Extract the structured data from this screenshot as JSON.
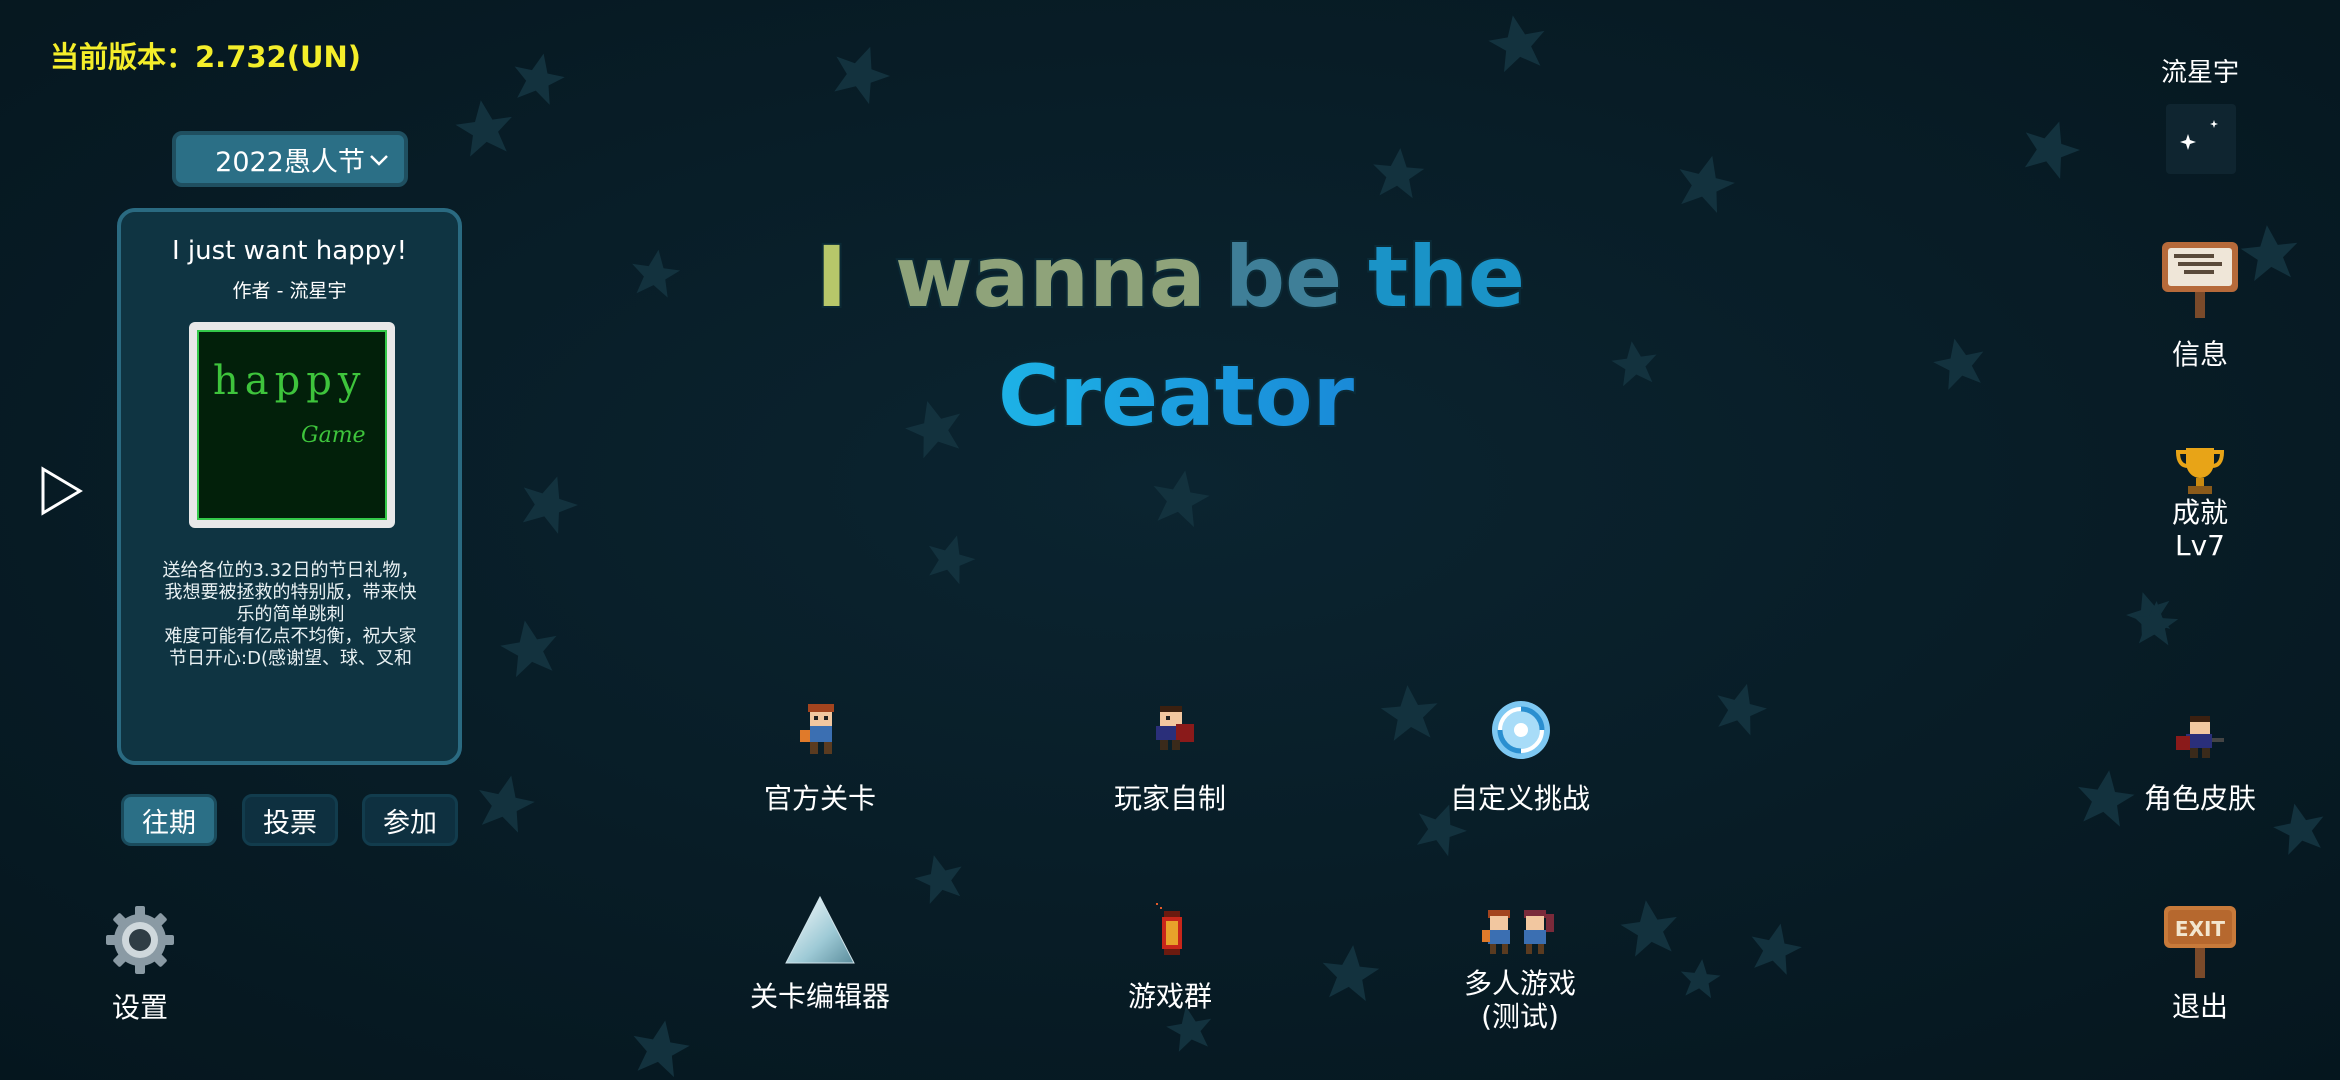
{
  "version_text": "当前版本：2.732(UN)",
  "event_selector": {
    "value": "2022愚人节"
  },
  "level_card": {
    "title": "I just want happy!",
    "author": "作者 - 流星宇",
    "thumbnail_text_1": "happy",
    "thumbnail_text_2": "Game",
    "description_lines": [
      "送给各位的3.32日的节日礼物，",
      "我想要被拯救的特别版，带来快",
      "乐的简单跳刺",
      "难度可能有亿点不均衡，祝大家",
      "节日开心:D(感谢望、球、叉和"
    ]
  },
  "tabs": [
    {
      "label": "往期",
      "active": true
    },
    {
      "label": "投票",
      "active": false
    },
    {
      "label": "参加",
      "active": false
    }
  ],
  "game_title": {
    "line1_words": [
      "I",
      "wanna",
      "be",
      "the"
    ],
    "line2": "Creator"
  },
  "menu": {
    "official": "官方关卡",
    "player_made": "玩家自制",
    "custom_challenge": "自定义挑战",
    "skins": "角色皮肤",
    "editor": "关卡编辑器",
    "game_group": "游戏群",
    "multiplayer_line1": "多人游戏",
    "multiplayer_line2": "(测试)",
    "settings": "设置",
    "exit": "退出"
  },
  "right_panel": {
    "username": "流星宇",
    "info": "信息",
    "achievement": "成就",
    "level": "Lv7",
    "signboard_text": "EXIT"
  },
  "colors": {
    "background": "#071c26",
    "version_yellow": "#f4ee2a",
    "panel": "#0f3442",
    "panel_border": "#2a6a81",
    "tab_active": "#2b6f86"
  }
}
